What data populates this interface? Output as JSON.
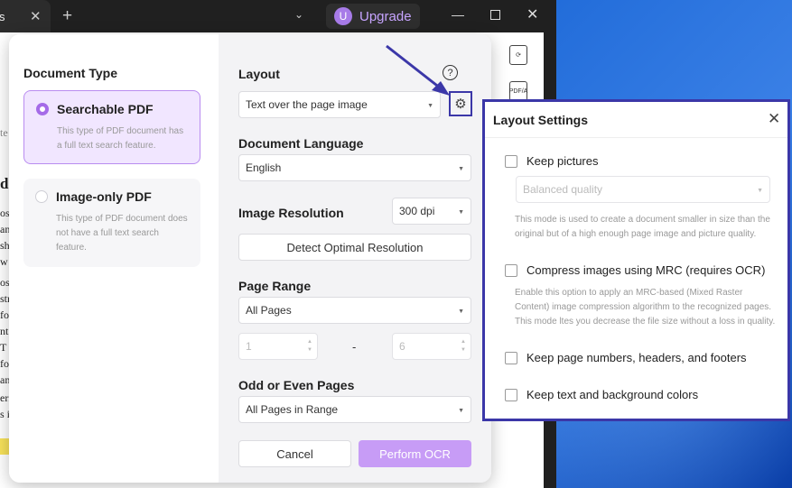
{
  "window": {
    "tab_text": "s",
    "upgrade": {
      "avatar_letter": "U",
      "label": "Upgrade"
    }
  },
  "background_doc": {
    "lines": [
      "te",
      "d",
      "os",
      "an",
      "sh",
      "w",
      "os",
      "str",
      "fo",
      "nt",
      "T",
      "fo",
      "an",
      "eri",
      "s i"
    ]
  },
  "rail": {
    "pdfa_label": "PDF/A"
  },
  "ocr": {
    "doc_type": {
      "title": "Document Type",
      "options": [
        {
          "label": "Searchable PDF",
          "desc": "This type of PDF document has a full text search feature.",
          "selected": true
        },
        {
          "label": "Image-only PDF",
          "desc": "This type of PDF document does not have a full text search feature.",
          "selected": false
        }
      ]
    },
    "layout": {
      "title": "Layout",
      "value": "Text over the page image"
    },
    "language": {
      "title": "Document Language",
      "value": "English"
    },
    "resolution": {
      "title": "Image Resolution",
      "value": "300 dpi",
      "detect_label": "Detect Optimal Resolution"
    },
    "page_range": {
      "title": "Page Range",
      "value": "All Pages",
      "from": "1",
      "dash": "-",
      "to": "6"
    },
    "odd_even": {
      "title": "Odd or Even Pages",
      "value": "All Pages in Range"
    },
    "cancel_label": "Cancel",
    "perform_label": "Perform OCR"
  },
  "layout_settings": {
    "title": "Layout Settings",
    "keep_pictures": "Keep pictures",
    "quality_value": "Balanced quality",
    "quality_hint": "This mode is used to create a document smaller in size than the original but of a high enough page image and picture quality.",
    "compress": "Compress images using MRC (requires OCR)",
    "compress_hint": "Enable this option to apply an MRC-based (Mixed Raster Content) image compression algorithm to the recognized pages. This mode ltes you decrease the file size without a loss in quality.",
    "keep_headers": "Keep page numbers, headers, and footers",
    "keep_colors": "Keep text and background colors"
  },
  "colors": {
    "accent": "#a56be8",
    "annotation": "#3b37a8",
    "primary_button": "#c79cf6"
  }
}
